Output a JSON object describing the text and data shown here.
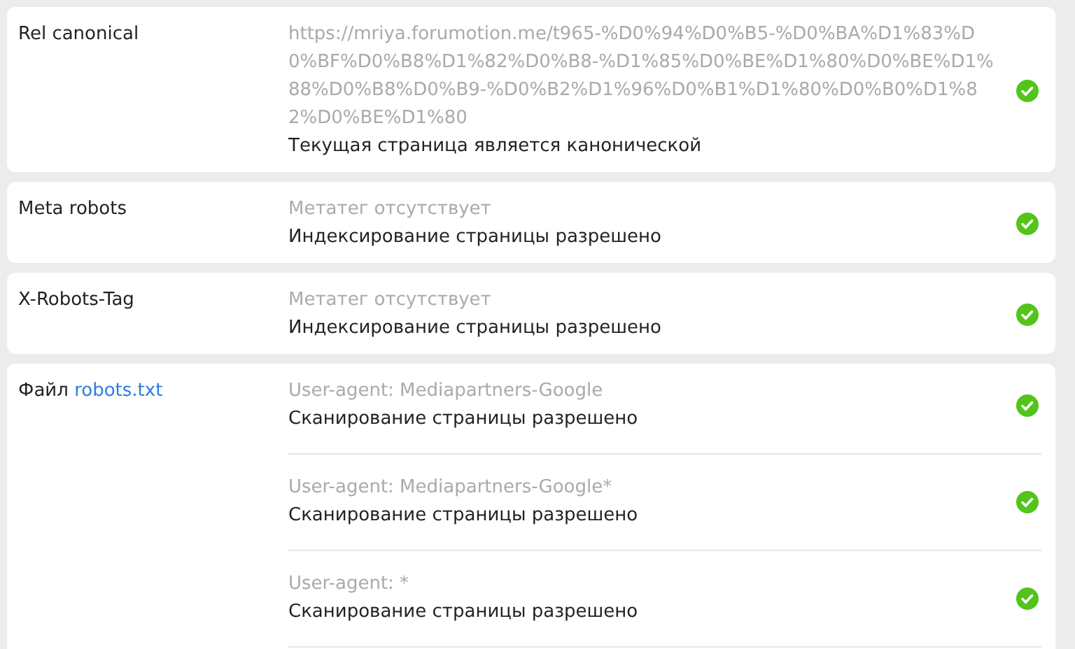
{
  "checks": [
    {
      "label": "Rel canonical",
      "entries": [
        {
          "detail": "https://mriya.forumotion.me/t965-%D0%94%D0%B5-%D0%BA%D1%83%D0%BF%D0%B8%D1%82%D0%B8-%D1%85%D0%BE%D1%80%D0%BE%D1%88%D0%B8%D0%B9-%D0%B2%D1%96%D0%B1%D1%80%D0%B0%D1%82%D0%BE%D1%80",
          "result": "Текущая страница является канонической",
          "passed": true
        }
      ]
    },
    {
      "label": "Meta robots",
      "entries": [
        {
          "detail": "Метатег отсутствует",
          "result": "Индексирование страницы разрешено",
          "passed": true
        }
      ]
    },
    {
      "label": "X-Robots-Tag",
      "entries": [
        {
          "detail": "Метатег отсутствует",
          "result": "Индексирование страницы разрешено",
          "passed": true
        }
      ]
    },
    {
      "label": "Файл",
      "link": "robots.txt",
      "entries": [
        {
          "detail": "User-agent: Mediapartners-Google",
          "result": "Сканирование страницы разрешено",
          "passed": true
        },
        {
          "detail": "User-agent: Mediapartners-Google*",
          "result": "Сканирование страницы разрешено",
          "passed": true
        },
        {
          "detail": "User-agent: *",
          "result": "Сканирование страницы разрешено",
          "passed": true
        }
      ]
    }
  ]
}
